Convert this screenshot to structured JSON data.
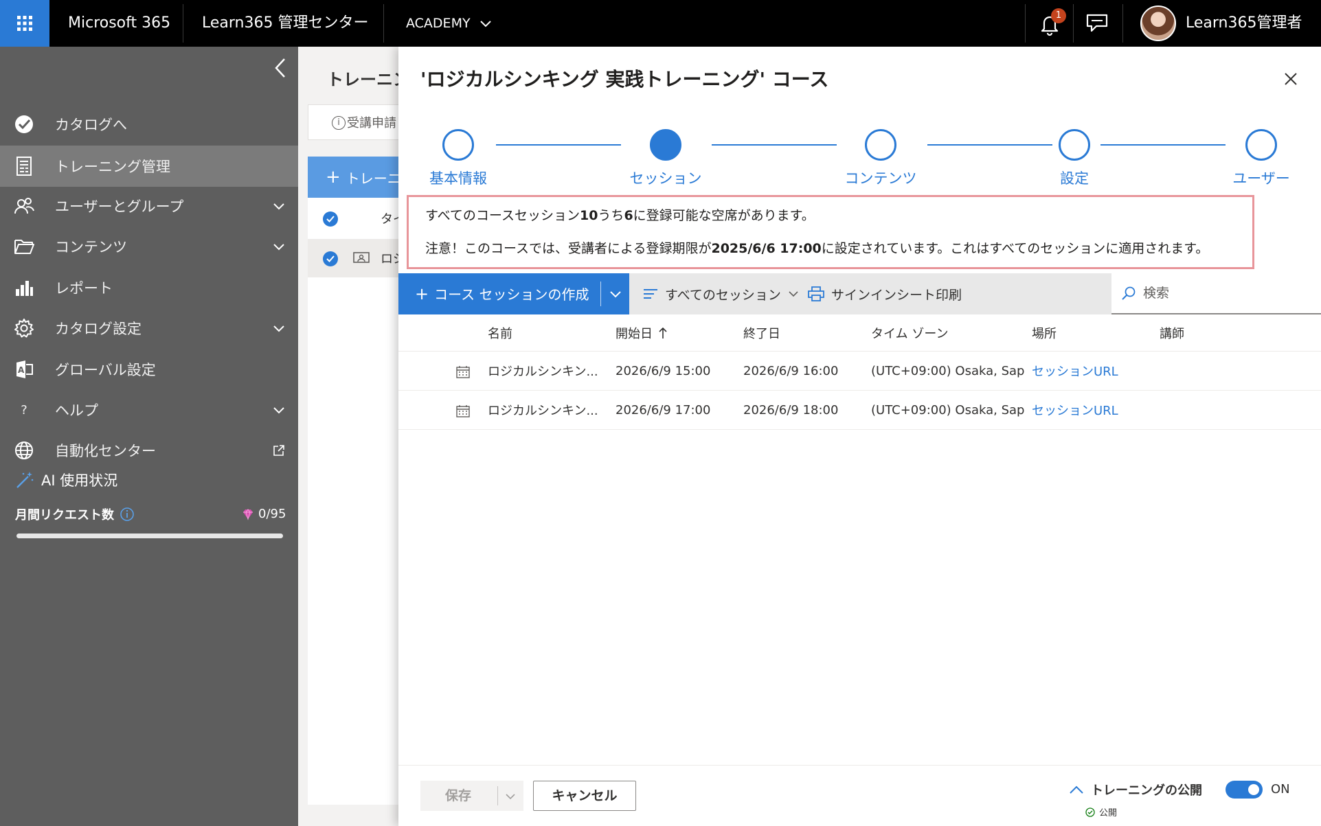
{
  "topbar": {
    "app_name": "Microsoft 365",
    "center_name": "Learn365 管理センター",
    "tenant": "ACADEMY",
    "notification_count": "1",
    "user_name": "Learn365管理者"
  },
  "sidebar": {
    "items": [
      {
        "label": "カタログへ",
        "icon": "catalog-check-icon"
      },
      {
        "label": "トレーニング管理",
        "icon": "document-icon"
      },
      {
        "label": "ユーザーとグループ",
        "icon": "people-icon"
      },
      {
        "label": "コンテンツ",
        "icon": "folder-icon"
      },
      {
        "label": "レポート",
        "icon": "bar-chart-icon"
      },
      {
        "label": "カタログ設定",
        "icon": "gear-icon"
      },
      {
        "label": "グローバル設定",
        "icon": "settings-app-icon"
      },
      {
        "label": "ヘルプ",
        "icon": "question-icon"
      },
      {
        "label": "自動化センター",
        "icon": "globe-icon"
      }
    ],
    "ai_usage": {
      "title": "AI 使用状況",
      "request_label": "月間リクエスト数",
      "request_count": "0/95",
      "used_fraction": 0
    }
  },
  "background_page": {
    "title": "トレーニン",
    "info_text": "受講申請",
    "new_button": "トレーニ",
    "rows": [
      "タイ",
      "ロジ"
    ]
  },
  "panel": {
    "title": "'ロジカルシンキング 実践トレーニング' コース",
    "steps": [
      {
        "label": "基本情報",
        "state": "done"
      },
      {
        "label": "セッション",
        "state": "current"
      },
      {
        "label": "コンテンツ",
        "state": "todo"
      },
      {
        "label": "設定",
        "state": "todo"
      },
      {
        "label": "ユーザー",
        "state": "todo"
      }
    ],
    "notice": {
      "line1_prefix": "すべてのコースセッション",
      "line1_total": "10",
      "line1_mid": "うち",
      "line1_open": "6",
      "line1_suffix": "に登録可能な空席があります。",
      "line2_prefix": "注意！このコースでは、受講者による登録期限が",
      "line2_deadline": "2025/6/6 17:00",
      "line2_suffix": "に設定されています。これはすべてのセッションに適用されます。"
    },
    "commands": {
      "create": "コース セッションの作成",
      "filter": "すべてのセッション",
      "print": "サインインシート印刷",
      "search_placeholder": "検索"
    },
    "columns": {
      "name": "名前",
      "start": "開始日",
      "end": "終了日",
      "timezone": "タイム ゾーン",
      "location": "場所",
      "instructor": "講師"
    },
    "rows": [
      {
        "name": "ロジカルシンキン...",
        "start": "2026/6/9 15:00",
        "end": "2026/6/9 16:00",
        "timezone": "(UTC+09:00) Osaka, Sap...",
        "location": "セッションURL",
        "instructor": ""
      },
      {
        "name": "ロジカルシンキン...",
        "start": "2026/6/9 17:00",
        "end": "2026/6/9 18:00",
        "timezone": "(UTC+09:00) Osaka, Sap...",
        "location": "セッションURL",
        "instructor": ""
      }
    ],
    "footer": {
      "save": "保存",
      "cancel": "キャンセル",
      "publish_label": "トレーニングの公開",
      "publish_state": "公開",
      "toggle_label": "ON"
    }
  },
  "colors": {
    "accent": "#2a7ad5",
    "notice_border": "#e8959a",
    "badge": "#c4431d"
  }
}
